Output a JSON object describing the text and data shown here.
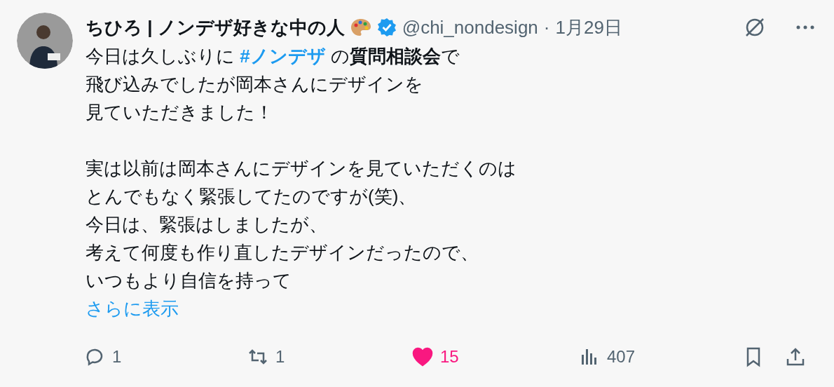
{
  "author": {
    "name": "ちひろ | ノンデザ好きな中の人",
    "verified": true,
    "handle": "@chi_nondesign",
    "separator": "·",
    "date": "1月29日"
  },
  "body": {
    "first_line": {
      "before": "今日は久しぶりに ",
      "hashtag": "#ノンデザ",
      "after": " の**質問相談会**で"
    },
    "paragraphs": [
      [
        "飛び込みでしたが岡本さんにデザインを",
        "見ていただきました！"
      ],
      [
        "実は以前は岡本さんにデザインを見ていただくのは",
        "とんでもなく緊張してたのですが(笑)、",
        "今日は、緊張はしましたが、",
        "考えて何度も作り直したデザインだったので、",
        "いつもより自信を持って"
      ]
    ],
    "show_more": "さらに表示"
  },
  "actions": [
    {
      "kind": "reply",
      "count": "1"
    },
    {
      "kind": "repost",
      "count": "1"
    },
    {
      "kind": "like",
      "count": "15",
      "liked": true
    },
    {
      "kind": "views",
      "count": "407"
    },
    {
      "kind": "bookmark"
    },
    {
      "kind": "share"
    }
  ]
}
